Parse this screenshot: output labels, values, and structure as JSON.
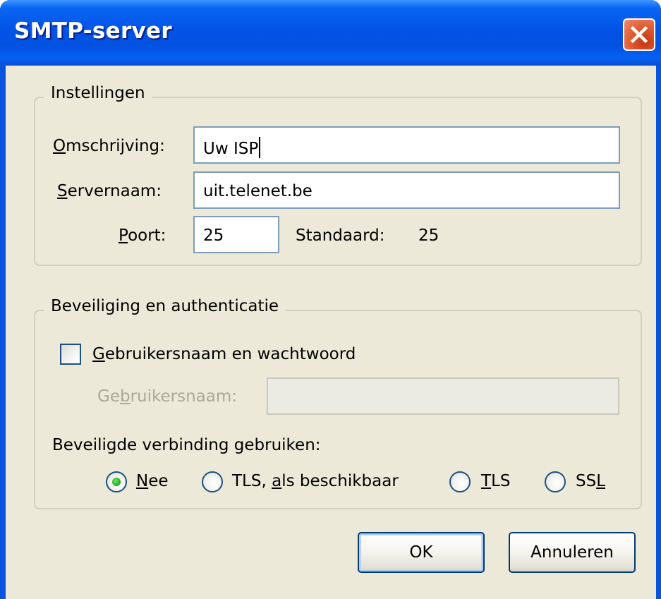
{
  "window": {
    "title": "SMTP-server",
    "close_icon": "close-x-icon"
  },
  "settings": {
    "legend": "Instellingen",
    "description_label_prefix": "O",
    "description_label_rest": "mschrijving:",
    "description_value": "Uw ISP",
    "server_label_prefix": "S",
    "server_label_rest": "ervernaam:",
    "server_value": "uit.telenet.be",
    "port_label_prefix": "P",
    "port_label_rest": "oort:",
    "port_value": "25",
    "default_label": "Standaard:",
    "default_value": "25"
  },
  "security": {
    "legend": "Beveiliging en authenticatie",
    "auth_checkbox_prefix": "G",
    "auth_checkbox_rest": "ebruikersnaam en wachtwoord",
    "auth_checked": false,
    "username_label_a": "Ge",
    "username_label_b": "b",
    "username_label_c": "ruikersnaam:",
    "username_value": "",
    "secure_conn_label": "Beveiligde verbinding gebruiken:",
    "radio_nee_prefix": "N",
    "radio_nee_rest": "ee",
    "radio_tls_avail_a": "TLS, ",
    "radio_tls_avail_b": "a",
    "radio_tls_avail_c": "ls beschikbaar",
    "radio_tls_prefix": "T",
    "radio_tls_rest": "LS",
    "radio_ssl_a": "SS",
    "radio_ssl_b": "L",
    "selected": "Nee"
  },
  "buttons": {
    "ok": "OK",
    "cancel": "Annuleren"
  }
}
